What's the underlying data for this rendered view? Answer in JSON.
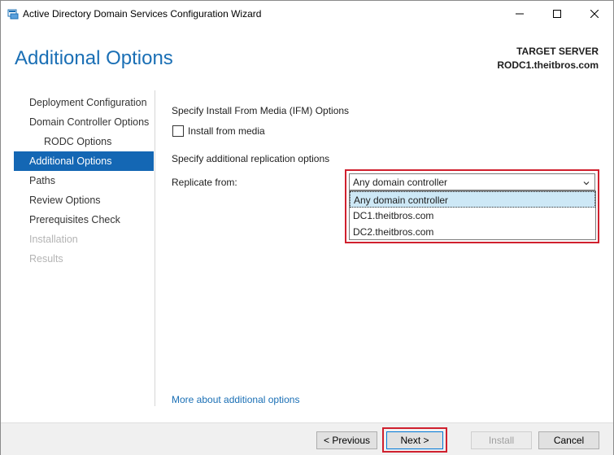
{
  "window": {
    "title": "Active Directory Domain Services Configuration Wizard"
  },
  "header": {
    "page_title": "Additional Options",
    "target_label": "TARGET SERVER",
    "target_name": "RODC1.theitbros.com"
  },
  "nav": {
    "items": [
      {
        "label": "Deployment Configuration",
        "state": "normal"
      },
      {
        "label": "Domain Controller Options",
        "state": "normal"
      },
      {
        "label": "RODC Options",
        "state": "sub"
      },
      {
        "label": "Additional Options",
        "state": "active"
      },
      {
        "label": "Paths",
        "state": "normal"
      },
      {
        "label": "Review Options",
        "state": "normal"
      },
      {
        "label": "Prerequisites Check",
        "state": "normal"
      },
      {
        "label": "Installation",
        "state": "disabled"
      },
      {
        "label": "Results",
        "state": "disabled"
      }
    ]
  },
  "content": {
    "ifm_title": "Specify Install From Media (IFM) Options",
    "ifm_checkbox_label": "Install from media",
    "ifm_checked": false,
    "replication_title": "Specify additional replication options",
    "replicate_from_label": "Replicate from:",
    "replicate_from_value": "Any domain controller",
    "replicate_options": [
      "Any domain controller",
      "DC1.theitbros.com",
      "DC2.theitbros.com"
    ],
    "more_link": "More about additional options"
  },
  "footer": {
    "previous": "< Previous",
    "next": "Next >",
    "install": "Install",
    "cancel": "Cancel"
  },
  "colors": {
    "accent": "#1467b4",
    "title_blue": "#1a6fb5",
    "highlight_red": "#d0202e",
    "dropdown_selected": "#cde8f6"
  }
}
